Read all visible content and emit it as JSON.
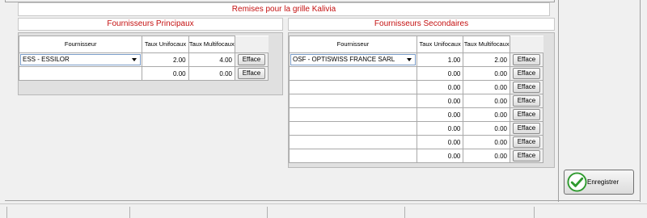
{
  "title": "Remises pour la grille Kalivia",
  "principal": {
    "title": "Fournisseurs Principaux",
    "headers": {
      "supplier": "Fournisseur",
      "unifocal": "Taux Unifocaux",
      "multifocal": "Taux Multifocaux"
    },
    "rows": [
      {
        "supplier": "ESS - ESSILOR",
        "unifocal": "2.00",
        "multifocal": "4.00",
        "button": "Efface"
      },
      {
        "supplier": "",
        "unifocal": "0.00",
        "multifocal": "0.00",
        "button": "Efface"
      }
    ]
  },
  "secondary": {
    "title": "Fournisseurs Secondaires",
    "headers": {
      "supplier": "Fournisseur",
      "unifocal": "Taux Unifocaux",
      "multifocal": "Taux Multifocaux"
    },
    "rows": [
      {
        "supplier": "OSF - OPTISWISS FRANCE SARL",
        "unifocal": "1.00",
        "multifocal": "2.00",
        "button": "Efface"
      },
      {
        "supplier": "",
        "unifocal": "0.00",
        "multifocal": "0.00",
        "button": "Efface"
      },
      {
        "supplier": "",
        "unifocal": "0.00",
        "multifocal": "0.00",
        "button": "Efface"
      },
      {
        "supplier": "",
        "unifocal": "0.00",
        "multifocal": "0.00",
        "button": "Efface"
      },
      {
        "supplier": "",
        "unifocal": "0.00",
        "multifocal": "0.00",
        "button": "Efface"
      },
      {
        "supplier": "",
        "unifocal": "0.00",
        "multifocal": "0.00",
        "button": "Efface"
      },
      {
        "supplier": "",
        "unifocal": "0.00",
        "multifocal": "0.00",
        "button": "Efface"
      },
      {
        "supplier": "",
        "unifocal": "0.00",
        "multifocal": "0.00",
        "button": "Efface"
      }
    ]
  },
  "save_button": {
    "label": "Enregistrer",
    "icon": "check-icon",
    "icon_color": "#2e9a2e"
  },
  "colors": {
    "accent_text": "#c41010"
  }
}
